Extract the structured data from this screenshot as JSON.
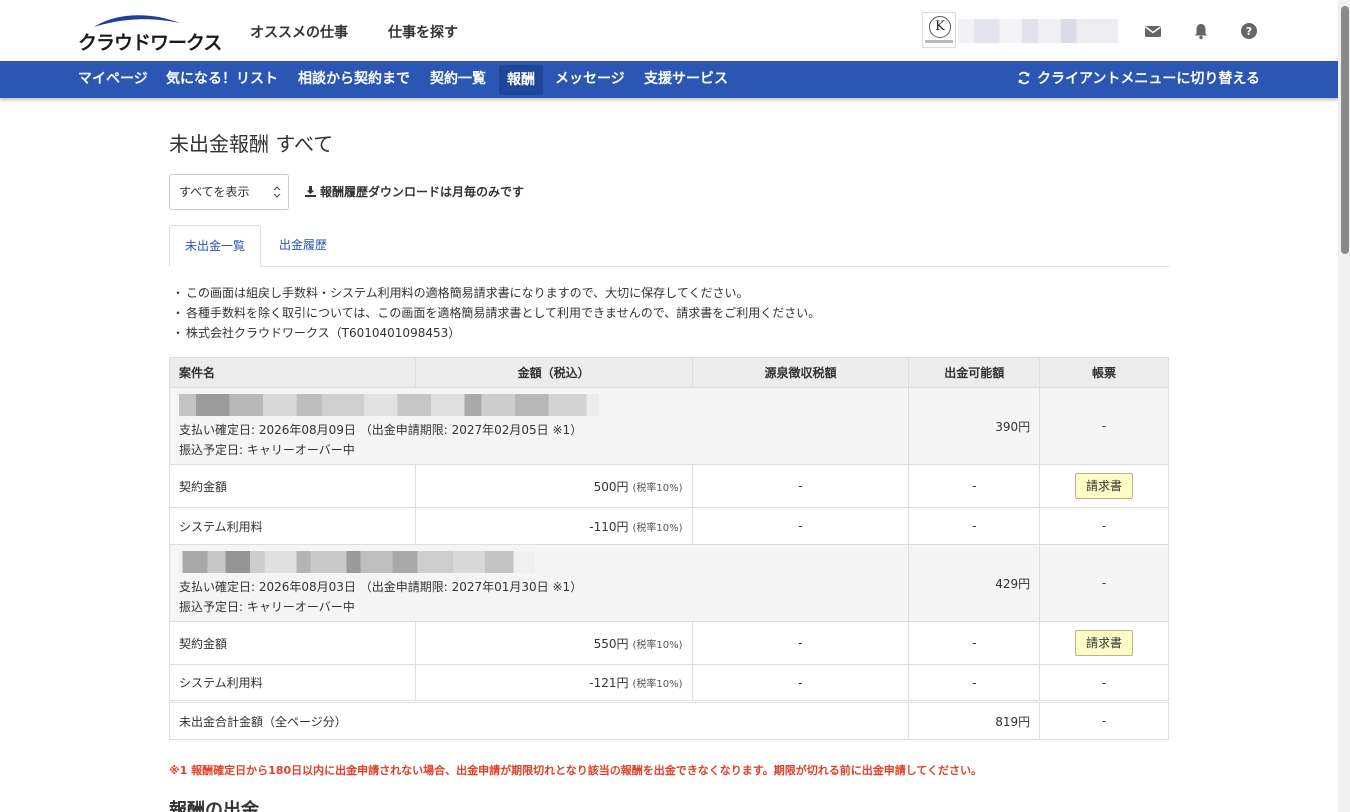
{
  "header": {
    "logo_text": "クラウドワークス",
    "nav": [
      "オススメの仕事",
      "仕事を探す"
    ],
    "avatar_letter": "K",
    "icons": [
      "mail-icon",
      "bell-icon",
      "help-icon"
    ]
  },
  "bluenav": {
    "items": [
      "マイページ",
      "気になる！リスト",
      "相談から契約まで",
      "契約一覧",
      "報酬",
      "メッセージ",
      "支援サービス"
    ],
    "active": "報酬",
    "switch_label": "クライアントメニューに切り替える"
  },
  "page": {
    "title": "未出金報酬 すべて",
    "filter_value": "すべてを表示",
    "download_note": "報酬履歴ダウンロードは月毎のみです",
    "tabs": [
      "未出金一覧",
      "出金履歴"
    ],
    "notes": [
      "この画面は組戻し手数料・システム利用料の適格簡易請求書になりますので、大切に保存してください。",
      "各種手数料を除く取引については、この画面を適格簡易請求書として利用できませんので、請求書をご利用ください。",
      "株式会社クラウドワークス（T6010401098453）"
    ]
  },
  "table": {
    "headers": [
      "案件名",
      "金額（税込）",
      "源泉徴収税額",
      "出金可能額",
      "帳票"
    ],
    "jobs": [
      {
        "confirm": "支払い確定日: 2026年08月09日 （出金申請期限: 2027年02月05日 ※1）",
        "transfer": "振込予定日: キャリーオーバー中",
        "available": "390円",
        "doc": "-",
        "rows": [
          {
            "label": "契約金額",
            "amount": "500円",
            "rate": "(税率10%)",
            "withholding": "-",
            "available": "-",
            "doc": "請求書"
          },
          {
            "label": "システム利用料",
            "amount": "-110円",
            "rate": "(税率10%)",
            "withholding": "-",
            "available": "-",
            "doc": "-"
          }
        ]
      },
      {
        "confirm": "支払い確定日: 2026年08月03日 （出金申請期限: 2027年01月30日 ※1）",
        "transfer": "振込予定日: キャリーオーバー中",
        "available": "429円",
        "doc": "-",
        "rows": [
          {
            "label": "契約金額",
            "amount": "550円",
            "rate": "(税率10%)",
            "withholding": "-",
            "available": "-",
            "doc": "請求書"
          },
          {
            "label": "システム利用料",
            "amount": "-121円",
            "rate": "(税率10%)",
            "withholding": "-",
            "available": "-",
            "doc": "-"
          }
        ]
      }
    ],
    "total": {
      "label": "未出金合計金額（全ページ分）",
      "amount": "819円",
      "doc": "-"
    }
  },
  "warning": "※1 報酬確定日から180日以内に出金申請されない場合、出金申請が期限切れとなり該当の報酬を出金できなくなります。期限が切れる前に出金申請してください。",
  "next_heading": "報酬の出金",
  "colors": {
    "nav_blue": "#2b56b3",
    "warning_red": "#e0402a",
    "invoice_yellow": "#fdfcc6"
  }
}
